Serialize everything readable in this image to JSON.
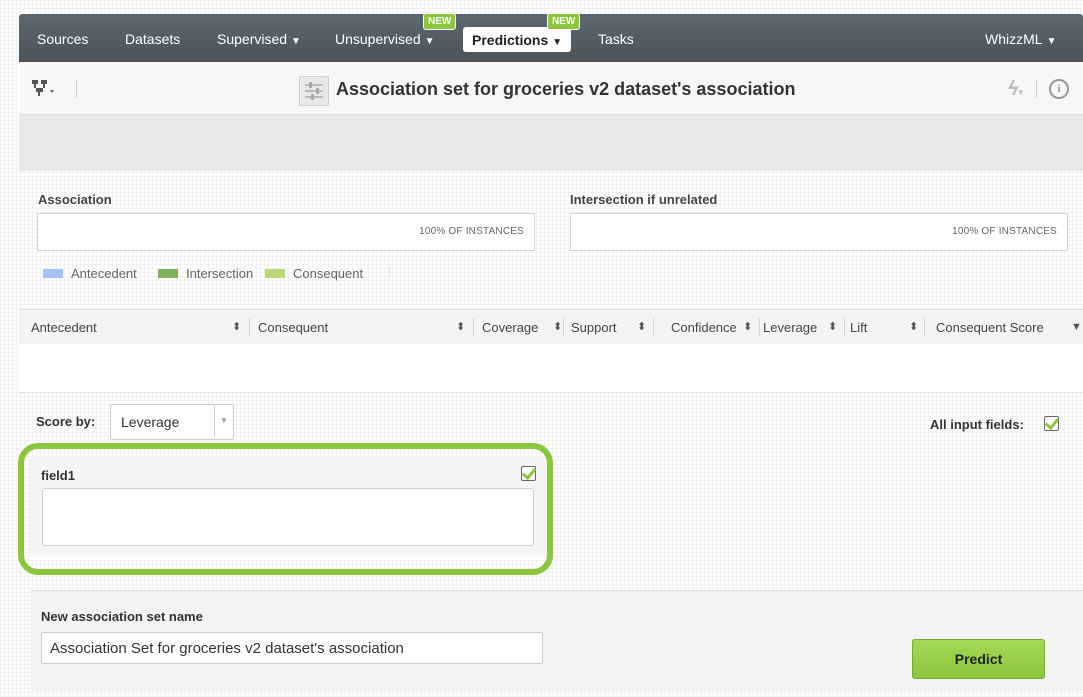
{
  "nav": {
    "items": [
      {
        "label": "Sources"
      },
      {
        "label": "Datasets"
      },
      {
        "label": "Supervised"
      },
      {
        "label": "Unsupervised",
        "badge": "NEW"
      },
      {
        "label": "Predictions",
        "badge": "NEW",
        "active": true
      },
      {
        "label": "Tasks"
      }
    ],
    "user_menu": "WhizzML"
  },
  "title": "Association set for groceries v2 dataset's association",
  "association": {
    "label": "Association",
    "instances": "100% OF INSTANCES"
  },
  "intersection": {
    "label": "Intersection if unrelated",
    "instances": "100% OF INSTANCES"
  },
  "legend": [
    {
      "label": "Antecedent",
      "color": "#a4c2f4"
    },
    {
      "label": "Intersection",
      "color": "#7fb35a"
    },
    {
      "label": "Consequent",
      "color": "#b9d97a"
    }
  ],
  "table_headers": [
    "Antecedent",
    "Consequent",
    "Coverage",
    "Support",
    "Confidence",
    "Leverage",
    "Lift",
    "Consequent Score"
  ],
  "score_by": {
    "label": "Score by:",
    "value": "Leverage"
  },
  "all_input_fields_label": "All input fields:",
  "field": {
    "name": "field1",
    "value": ""
  },
  "new_set": {
    "label": "New association set name",
    "value": "Association Set for groceries v2 dataset's association"
  },
  "predict_button": "Predict",
  "colors": {
    "nav_bg": "#505960",
    "accent_green": "#8cc63f"
  }
}
